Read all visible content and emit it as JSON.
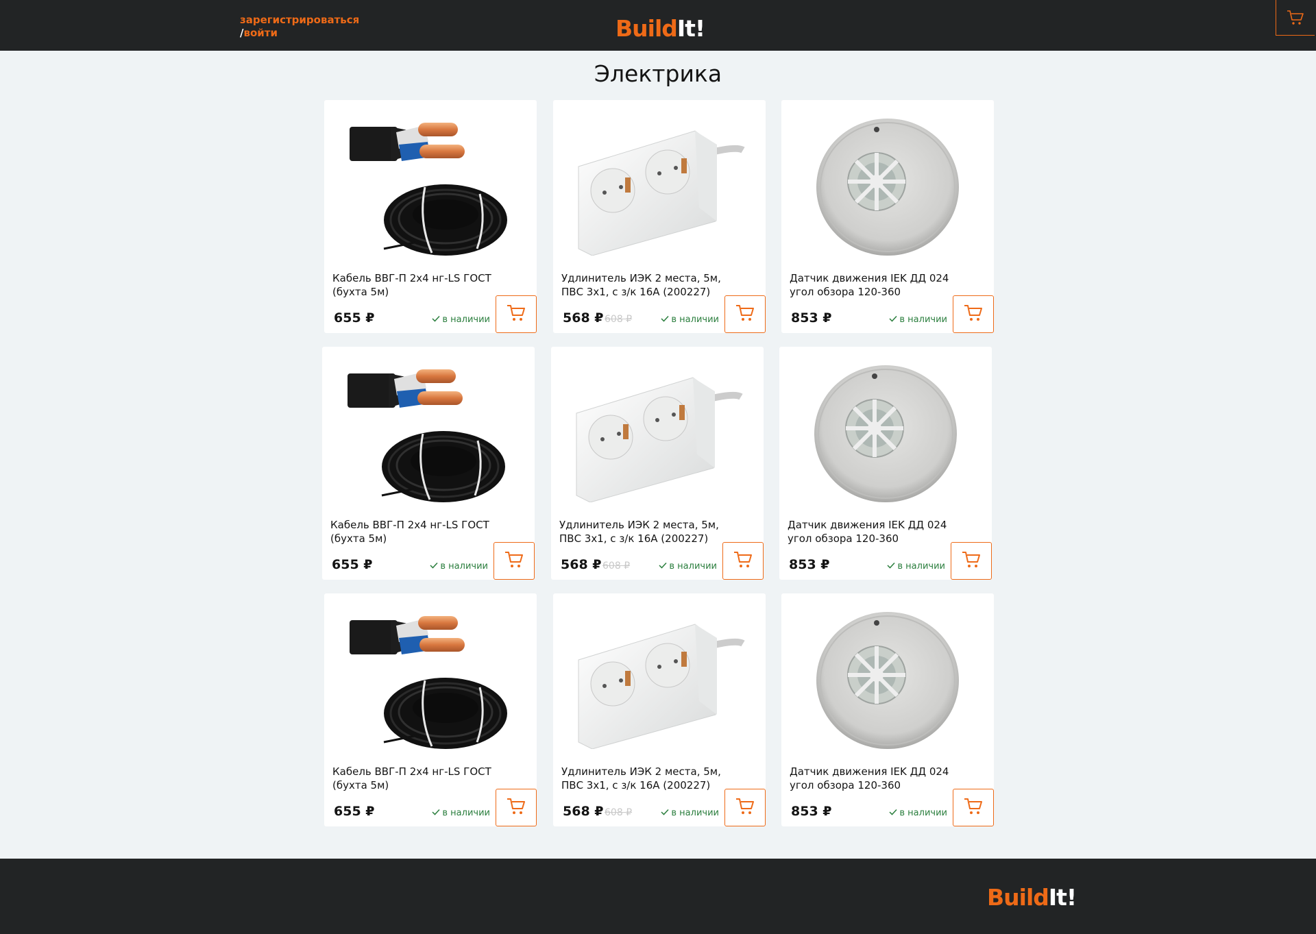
{
  "header": {
    "register_label": "зарегистрироваться",
    "login_slash": "/",
    "login_label": "войти",
    "logo_part1": "Build",
    "logo_part2": "It!",
    "cart_icon": "cart-icon"
  },
  "page": {
    "title": "Электрика"
  },
  "colors": {
    "accent": "#ee6a17",
    "header_bg": "#222425",
    "page_bg": "#eff3f5",
    "in_stock": "#2a7e3d"
  },
  "products": [
    {
      "name": "Кабель ВВГ-П 2х4 нг-LS ГОСТ (бухта 5м)",
      "price": "655 ₽",
      "old_price": "",
      "stock": "в наличии",
      "image": "cable-image"
    },
    {
      "name": "Удлинитель ИЭК 2 места, 5м, ПВС 3х1, с з/к 16А (200227)",
      "price": "568 ₽",
      "old_price": "608 ₽",
      "stock": "в наличии",
      "image": "extension-cord-image"
    },
    {
      "name": "Датчик движения IEK ДД 024 угол обзора 120-360",
      "price": "853 ₽",
      "old_price": "",
      "stock": "в наличии",
      "image": "motion-sensor-image"
    },
    {
      "name": "Кабель ВВГ-П 2х4 нг-LS ГОСТ (бухта 5м)",
      "price": "655 ₽",
      "old_price": "",
      "stock": "в наличии",
      "image": "cable-image"
    },
    {
      "name": "Удлинитель ИЭК 2 места, 5м, ПВС 3х1, с з/к 16А (200227)",
      "price": "568 ₽",
      "old_price": "608 ₽",
      "stock": "в наличии",
      "image": "extension-cord-image"
    },
    {
      "name": "Датчик движения IEK ДД 024 угол обзора 120-360",
      "price": "853 ₽",
      "old_price": "",
      "stock": "в наличии",
      "image": "motion-sensor-image"
    },
    {
      "name": "Кабель ВВГ-П 2х4 нг-LS ГОСТ (бухта 5м)",
      "price": "655 ₽",
      "old_price": "",
      "stock": "в наличии",
      "image": "cable-image"
    },
    {
      "name": "Удлинитель ИЭК 2 места, 5м, ПВС 3х1, с з/к 16А (200227)",
      "price": "568 ₽",
      "old_price": "608 ₽",
      "stock": "в наличии",
      "image": "extension-cord-image"
    },
    {
      "name": "Датчик движения IEK ДД 024 угол обзора 120-360",
      "price": "853 ₽",
      "old_price": "",
      "stock": "в наличии",
      "image": "motion-sensor-image"
    }
  ],
  "footer": {
    "logo_part1": "Build",
    "logo_part2": "It!"
  }
}
